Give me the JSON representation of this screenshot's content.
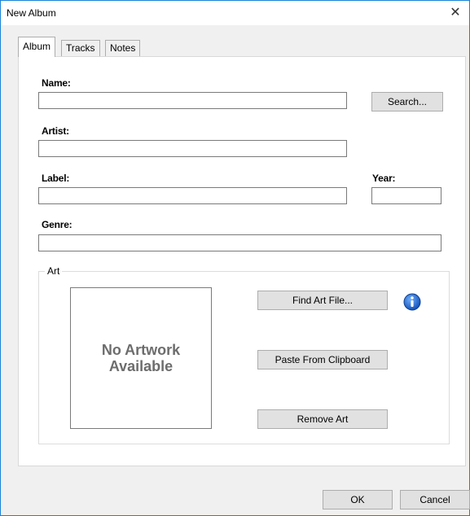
{
  "window": {
    "title": "New Album",
    "close_symbol": "✕"
  },
  "tabs": [
    {
      "label": "Album",
      "active": true
    },
    {
      "label": "Tracks",
      "active": false
    },
    {
      "label": "Notes",
      "active": false
    }
  ],
  "form": {
    "name_label": "Name:",
    "name_value": "",
    "search_button": "Search...",
    "artist_label": "Artist:",
    "artist_value": "",
    "label_label": "Label:",
    "label_value": "",
    "year_label": "Year:",
    "year_value": "",
    "genre_label": "Genre:",
    "genre_value": ""
  },
  "art": {
    "group_label": "Art",
    "placeholder": "No Artwork\nAvailable",
    "find_button": "Find Art File...",
    "info_icon": "info-icon",
    "paste_button": "Paste From Clipboard",
    "remove_button": "Remove Art"
  },
  "footer": {
    "ok_button": "OK",
    "cancel_button": "Cancel"
  },
  "colors": {
    "window_border": "#1883d7",
    "dialog_bg": "#f0f0f0",
    "panel_bg": "#ffffff",
    "button_bg": "#e1e1e1",
    "info_blue": "#1c6fd0"
  }
}
